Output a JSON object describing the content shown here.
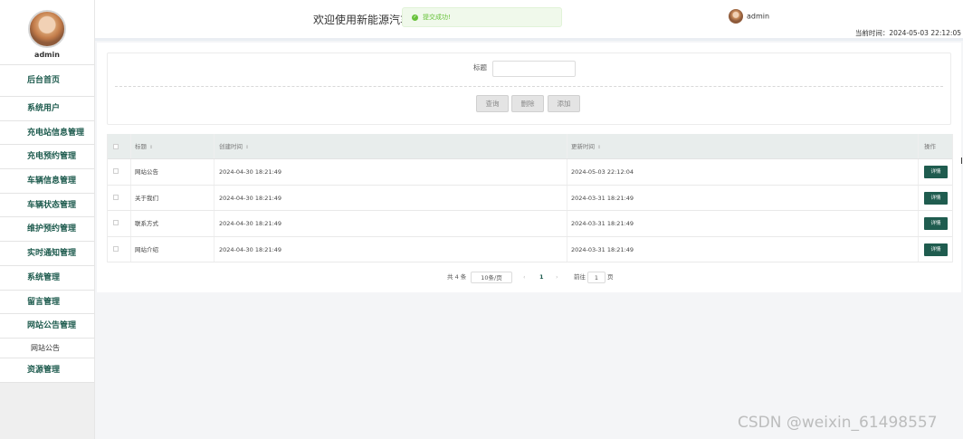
{
  "sidebar": {
    "username": "admin",
    "items": [
      {
        "label": "后台首页"
      },
      {
        "label": "系统用户"
      },
      {
        "label": "充电站信息管理"
      },
      {
        "label": "充电预约管理"
      },
      {
        "label": "车辆信息管理"
      },
      {
        "label": "车辆状态管理"
      },
      {
        "label": "维护预约管理"
      },
      {
        "label": "实时通知管理"
      },
      {
        "label": "系统管理"
      },
      {
        "label": "留言管理"
      },
      {
        "label": "网站公告管理"
      }
    ],
    "sub_item": "网站公告",
    "last_item": "资源管理"
  },
  "header": {
    "welcome": "欢迎使用新能源汽车服",
    "toast": "提交成功!",
    "username": "admin",
    "clock": "当前时间：2024-05-03 22:12:05"
  },
  "search": {
    "label": "标题",
    "placeholder": "",
    "buttons": {
      "query": "查询",
      "delete": "删除",
      "add": "添加"
    }
  },
  "table": {
    "columns": {
      "title": "标题",
      "created": "创建时间",
      "updated": "更新时间",
      "action": "操作"
    },
    "rows": [
      {
        "title": "网站公告",
        "created": "2024-04-30 18:21:49",
        "updated": "2024-05-03 22:12:04",
        "action": "详情"
      },
      {
        "title": "关于我们",
        "created": "2024-04-30 18:21:49",
        "updated": "2024-03-31 18:21:49",
        "action": "详情"
      },
      {
        "title": "联系方式",
        "created": "2024-04-30 18:21:49",
        "updated": "2024-03-31 18:21:49",
        "action": "详情"
      },
      {
        "title": "网站介绍",
        "created": "2024-04-30 18:21:49",
        "updated": "2024-03-31 18:21:49",
        "action": "详情"
      }
    ]
  },
  "pagination": {
    "total": "共 4 条",
    "page_size": "10条/页",
    "prev": "‹",
    "current": "1",
    "next": "›",
    "goto_label": "前往",
    "goto_value": "1",
    "page_unit": "页"
  },
  "colors": {
    "accent": "#1f5c4f",
    "toast_text": "#67c23a",
    "header_row": "#e8edec"
  },
  "watermark": "CSDN @weixin_61498557"
}
